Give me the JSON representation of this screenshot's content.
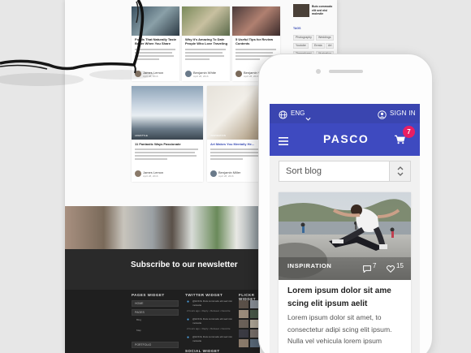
{
  "mobile": {
    "language": "ENG",
    "sign_in": "SIGN IN",
    "brand": "PASCO",
    "cart_count": "7",
    "sort": {
      "value": "Sort blog"
    },
    "post": {
      "category": "INSPIRATION",
      "comments": "7",
      "likes": "15",
      "title": "Lorem ipsum dolor sit ame scing elit ipsum aelit",
      "excerpt": "Lorem ipsum dolor sit amet, to consectetur adipi scing elit ipsum. Nulla vel vehicula lorem ipsum"
    }
  },
  "desktop": {
    "cards_row1": [
      {
        "title": "Foods That Naturally Taste Better When You Share",
        "author": "James Lemon",
        "date": "April 28, 2016"
      },
      {
        "title": "Why It's Amazing To Date People Who Love Traveling",
        "author": "Benjamin White",
        "date": "April 28, 2016"
      },
      {
        "title": "5 Useful Tips for Review Contents",
        "author": "Benjamin White",
        "date": "April 28, 2016"
      }
    ],
    "cards_row2": [
      {
        "category": "LIFESTYLE",
        "title": "11 Fantastic Ways Passionate",
        "author": "James Lemon",
        "date": "April 28, 2016"
      },
      {
        "category": "INSPIRATION",
        "title": "Art Makes You Mentally He...",
        "author": "Benjamin Miller",
        "date": "April 28, 2016"
      }
    ],
    "sidebar": {
      "recent_post": "Buis commodo elit sed nisi molestie",
      "tags_heading": "TAGS",
      "tags": [
        "Photography",
        "Weddings",
        "Youtube",
        "Errata",
        "Art",
        "Themeforest",
        "Illustration"
      ]
    },
    "newsletter": {
      "title": "Subscribe to our newsletter"
    },
    "footer": {
      "pages_heading": "PAGES WIDGET",
      "twitter_heading": "TWITTER WIDGET",
      "flickr_heading": "FLICKR WIDGET",
      "social_heading": "SOCIAL WIDGET",
      "pages": [
        "HOME",
        "PAGES",
        "BLOG",
        "PORTFOLIO"
      ],
      "pages_sub": [
        "Blog",
        "Map"
      ],
      "tweets": [
        "@HOCIL Duis commodo elit sed nisi molestie",
        "@HOCIL Duis commodo elit sed nisi molestie",
        "@HOCIL Duis commodo elit sed nisi molestie"
      ],
      "tweet_meta": "2 hours ago • Reply • Retweet • Favorite"
    }
  },
  "colors": {
    "primary": "#3e4ac0",
    "topbar": "#3a45b0",
    "cart_badge": "#e91e63",
    "footer": "#1f1f1f"
  }
}
